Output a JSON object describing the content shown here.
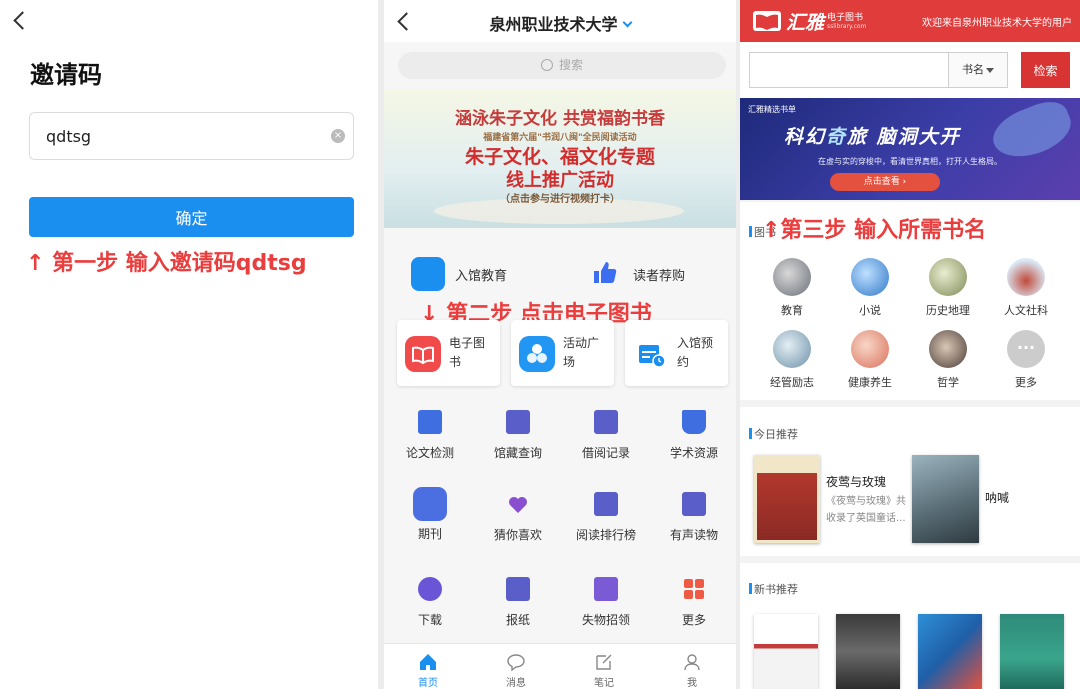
{
  "panel1": {
    "title": "邀请码",
    "input_value": "qdtsg",
    "clear_glyph": "×",
    "confirm_label": "确定",
    "step_note": "↑ 第一步 输入邀请码qdtsg"
  },
  "panel2": {
    "title": "泉州职业技术大学",
    "search_placeholder": "搜索",
    "banner": {
      "line1": "涵泳朱子文化 共赏福韵书香",
      "line2": "福建省第六届\"书润八闽\"全民阅读活动",
      "line3": "朱子文化、福文化专题",
      "line4": "线上推广活动",
      "line5": "（点击参与进行视频打卡）"
    },
    "quick_links": [
      {
        "label": "入馆教育",
        "color": "#1a8ff0"
      },
      {
        "label": "读者荐购",
        "color": "#3b6ef0"
      }
    ],
    "step_note": "↓ 第二步 点击电子图书",
    "cards": [
      {
        "label": "电子图书",
        "color": "#f04a4a"
      },
      {
        "label": "活动广场",
        "color": "#2196f3"
      },
      {
        "label": "入馆预约",
        "color": "#1a8ff0"
      }
    ],
    "grid": [
      {
        "label": "论文检测",
        "color": "#3f6ee0"
      },
      {
        "label": "馆藏查询",
        "color": "#5a5ec9"
      },
      {
        "label": "借阅记录",
        "color": "#5a5ec9"
      },
      {
        "label": "学术资源",
        "color": "#3f6ee0"
      },
      {
        "label": "期刊",
        "color": "#4b6fe0"
      },
      {
        "label": "猜你喜欢",
        "color": "#8a4fd0"
      },
      {
        "label": "阅读排行榜",
        "color": "#5a5ec9"
      },
      {
        "label": "有声读物",
        "color": "#5a5ec9"
      },
      {
        "label": "下载",
        "color": "#6a55d6"
      },
      {
        "label": "报纸",
        "color": "#5a5ec9"
      },
      {
        "label": "失物招领",
        "color": "#7b5ad6"
      },
      {
        "label": "更多",
        "color": "#ef5a45"
      }
    ],
    "tabs": [
      {
        "label": "首页",
        "color": "#1a8ff0"
      },
      {
        "label": "消息",
        "color": "#888888"
      },
      {
        "label": "笔记",
        "color": "#888888"
      },
      {
        "label": "我",
        "color": "#888888"
      }
    ]
  },
  "panel3": {
    "brand_name": "汇雅",
    "brand_sub": "电子图书",
    "brand_domain": "sslibrary.com",
    "welcome": "欢迎来自泉州职业技术大学的用户",
    "search_value": "",
    "search_field": "书名",
    "search_button": "检索",
    "banner": {
      "tag": "汇雅精选书单",
      "title_a": "科幻",
      "title_b": "奇",
      "title_c": "旅",
      "title_d": " 脑洞大开",
      "subtitle": "在虚与实的穿梭中，看清世界真相，打开人生格局。",
      "button": "点击查看 ›"
    },
    "category_heading": "图书",
    "step_note": "↑第三步 输入所需书名",
    "categories": [
      {
        "label": "教育",
        "color": "#8a8f99"
      },
      {
        "label": "小说",
        "color": "#4a8fd6"
      },
      {
        "label": "历史地理",
        "color": "#9aa870"
      },
      {
        "label": "人文社科",
        "color": "#b24a3c"
      },
      {
        "label": "经管励志",
        "color": "#7fa3b8"
      },
      {
        "label": "健康养生",
        "color": "#e08c7a"
      },
      {
        "label": "哲学",
        "color": "#5a4a45"
      },
      {
        "label": "更多",
        "color": "#cccccc"
      }
    ],
    "more_glyph": "···",
    "recommend_heading": "今日推荐",
    "recommend": [
      {
        "title": "夜莺与玫瑰",
        "desc": "《夜莺与玫瑰》共收录了英国童话...",
        "color": "#b3382e"
      },
      {
        "title": "呐喊",
        "desc": "",
        "color": "#5b6f78"
      }
    ],
    "new_heading": "新书推荐",
    "new_books": [
      {
        "color": "#c43b3b"
      },
      {
        "color": "#4a4a4a"
      },
      {
        "color": "#2e8fd6"
      },
      {
        "color": "#2e8a7a"
      }
    ]
  }
}
